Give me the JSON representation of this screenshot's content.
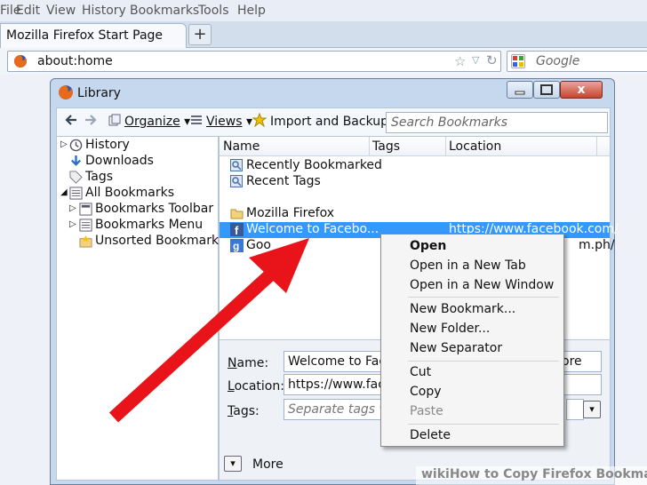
{
  "menubar": [
    "File",
    "Edit",
    "View",
    "History",
    "Bookmarks",
    "Tools",
    "Help"
  ],
  "browser": {
    "tab_title": "Mozilla Firefox Start Page",
    "new_tab": "+",
    "url": "about:home",
    "search_placeholder": "Google"
  },
  "library": {
    "title": "Library",
    "close": "x",
    "toolbar": {
      "organize": "Organize",
      "views": "Views",
      "import_backup": "Import and Backup",
      "search_placeholder": "Search Bookmarks"
    },
    "tree": [
      "History",
      "Downloads",
      "Tags",
      "All Bookmarks",
      "Bookmarks Toolbar",
      "Bookmarks Menu",
      "Unsorted Bookmarks"
    ],
    "columns": {
      "name": "Name",
      "tags": "Tags",
      "location": "Location"
    },
    "rows": [
      {
        "name": "Recently Bookmarked",
        "location": ""
      },
      {
        "name": "Recent Tags",
        "location": ""
      },
      {
        "name": "Mozilla Firefox",
        "location": ""
      },
      {
        "name": "Welcome to Facebo...",
        "location": "https://www.facebook.com/"
      },
      {
        "name": "Goo",
        "location": "m.ph/"
      }
    ],
    "details": {
      "name_label": "Name:",
      "name_value": "Welcome to Face",
      "location_label": "Location:",
      "location_value": "https://www.faceb",
      "tags_label": "Tags:",
      "tags_placeholder": "Separate tags with",
      "name_tail": "ore",
      "more": "More"
    }
  },
  "context_menu": {
    "items": [
      "Open",
      "Open in a New Tab",
      "Open in a New Window",
      "New Bookmark...",
      "New Folder...",
      "New Separator",
      "Cut",
      "Copy",
      "Paste",
      "Delete"
    ]
  },
  "watermark": "wikiHow to Copy Firefox Bookmarks",
  "colors": {
    "selection": "#3399ff",
    "arrow": "#e8141a"
  }
}
